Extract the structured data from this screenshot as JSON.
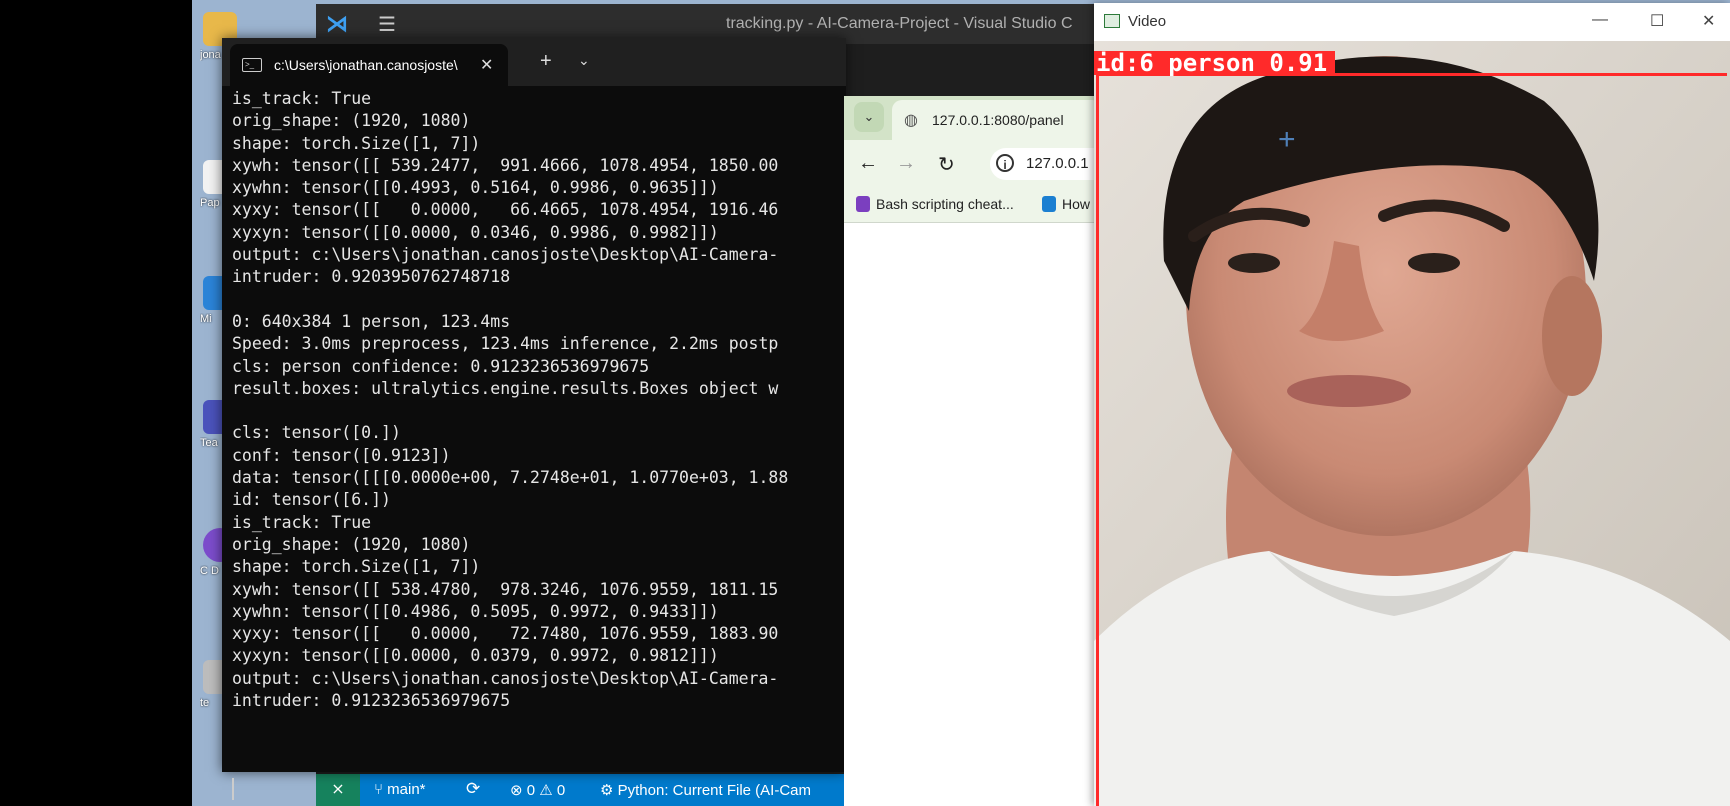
{
  "desktop": {
    "icons": [
      {
        "label": "jona",
        "color": "#e8b84a"
      },
      {
        "label": "Pap",
        "color": "#f3f3f3"
      },
      {
        "label": "Mi",
        "color": "#2b84d8"
      },
      {
        "label": "Tea",
        "color": "#4b53bc"
      },
      {
        "label": "C D",
        "color": "#7c4dcc"
      },
      {
        "label": "te",
        "color": "#bdbdbd"
      }
    ]
  },
  "vscode": {
    "title": "tracking.py - AI-Camera-Project - Visual Studio C",
    "status": {
      "remote_icon": "⨯",
      "branch": "main*",
      "sync_icon": "⟳",
      "problems": "⊗ 0 ⚠ 0",
      "python": "Python: Current File (AI-Cam"
    }
  },
  "terminal": {
    "tab_title": "c:\\Users\\jonathan.canosjoste\\",
    "lines": [
      "is_track: True",
      "orig_shape: (1920, 1080)",
      "shape: torch.Size([1, 7])",
      "xywh: tensor([[ 539.2477,  991.4666, 1078.4954, 1850.00",
      "xywhn: tensor([[0.4993, 0.5164, 0.9986, 0.9635]])",
      "xyxy: tensor([[   0.0000,   66.4665, 1078.4954, 1916.46",
      "xyxyn: tensor([[0.0000, 0.0346, 0.9986, 0.9982]])",
      "output: c:\\Users\\jonathan.canosjoste\\Desktop\\AI-Camera-",
      "intruder: 0.9203950762748718",
      "",
      "0: 640x384 1 person, 123.4ms",
      "Speed: 3.0ms preprocess, 123.4ms inference, 2.2ms postp",
      "cls: person confidence: 0.9123236536979675",
      "result.boxes: ultralytics.engine.results.Boxes object w",
      "",
      "cls: tensor([0.])",
      "conf: tensor([0.9123])",
      "data: tensor([[[0.0000e+00, 7.2748e+01, 1.0770e+03, 1.88",
      "id: tensor([6.])",
      "is_track: True",
      "orig_shape: (1920, 1080)",
      "shape: torch.Size([1, 7])",
      "xywh: tensor([[ 538.4780,  978.3246, 1076.9559, 1811.15",
      "xywhn: tensor([[0.4986, 0.5095, 0.9972, 0.9433]])",
      "xyxy: tensor([[   0.0000,   72.7480, 1076.9559, 1883.90",
      "xyxyn: tensor([[0.0000, 0.0379, 0.9972, 0.9812]])",
      "output: c:\\Users\\jonathan.canosjoste\\Desktop\\AI-Camera-",
      "intruder: 0.9123236536979675"
    ]
  },
  "browser": {
    "tab_title": "127.0.0.1:8080/panel",
    "url": "127.0.0.1",
    "bookmarks": [
      {
        "label": "Bash scripting cheat...",
        "color": "#7b3fbf"
      },
      {
        "label": "How",
        "color": "#1b7fd1"
      }
    ]
  },
  "video": {
    "title": "Video",
    "detection_label": "id:6 person 0.91",
    "box_color": "#ff2a2a"
  }
}
